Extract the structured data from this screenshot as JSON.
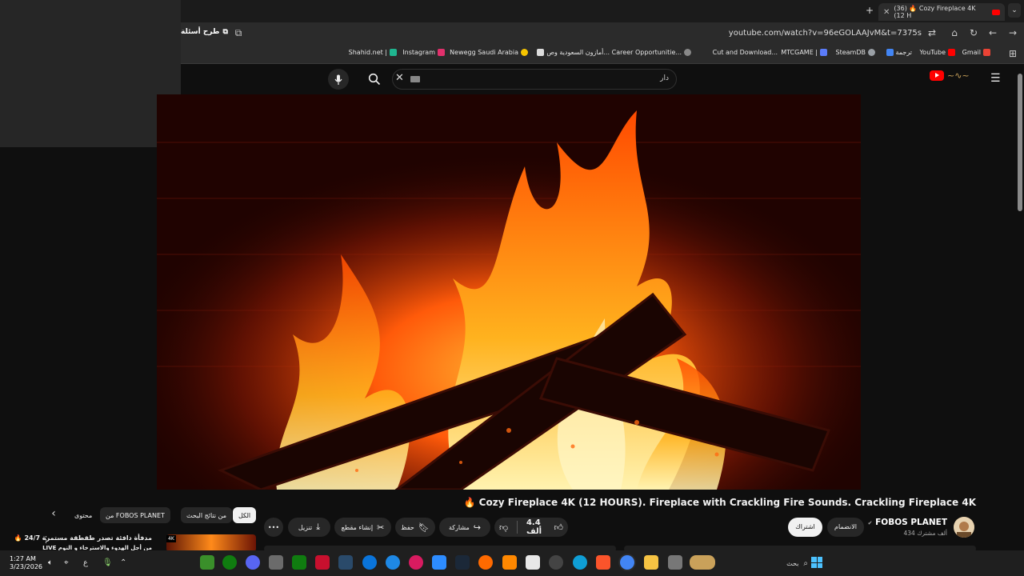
{
  "browser": {
    "tab_title": "(36) 🔥 Cozy Fireplace 4K (12 H",
    "url": "youtube.com/watch?v=96eGOLAAJvM&t=7375s",
    "ask_label": "طرح أسئلة",
    "bookmarks": [
      "Gmail",
      "YouTube",
      "ترجمة",
      "SteamDB",
      "MTCGAME |",
      "Cut and Download...",
      "Career Opportunitie...",
      "أمازون السعودية وص...",
      "Newegg Saudi Arabia",
      "Instagram",
      "Shahid.net |"
    ]
  },
  "youtube": {
    "search_text": "دار",
    "video": {
      "title": "🔥 Cozy Fireplace 4K (12 HOURS). Fireplace with Crackling Fire Sounds. Crackling Fireplace 4K",
      "channel": "FOBOS PLANET",
      "subscribers": "434 ألف مشترك",
      "subscribe_label": "اشتراك",
      "join_label": "الانضمام",
      "likes": "4.4 ألف",
      "share_label": "مشاركة",
      "save_label": "حفظ",
      "clip_label": "إنشاء مقطع",
      "download_label": "تنزيل",
      "more_label": "•••"
    },
    "chips": [
      "الكل",
      "من نتائج البحث",
      "من FOBOS PLANET",
      "محتوى"
    ],
    "suggestion": {
      "title": "🔥 مدفأة دافئة تصدر طقطقة مستمرة 24/7",
      "subtitle": "LIVE من أجل الهدوء والاسترخاء و النوم",
      "badge": "4K"
    }
  },
  "taskbar": {
    "time": "1:27 AM",
    "date": "3/23/2026",
    "lang": "ع",
    "search_label": "بحث"
  }
}
